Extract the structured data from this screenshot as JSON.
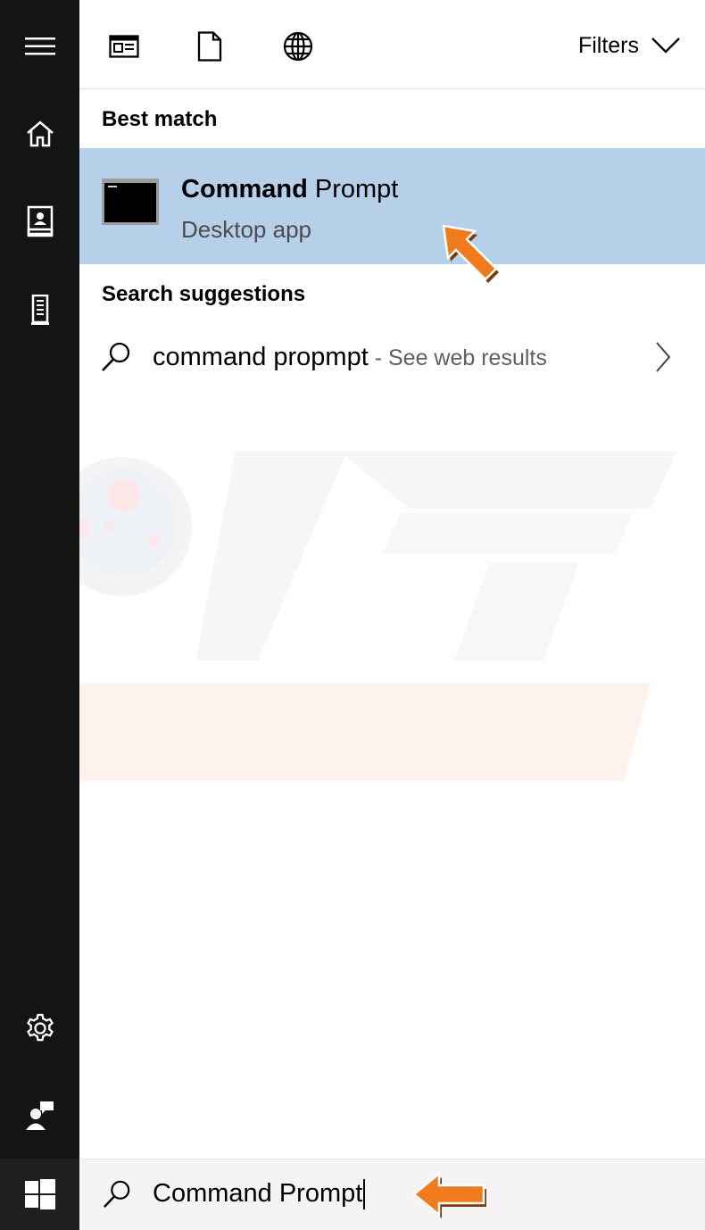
{
  "rail": {
    "items": [
      {
        "name": "menu",
        "icon": "hamburger-menu-icon"
      },
      {
        "name": "home",
        "icon": "home-icon"
      },
      {
        "name": "notebook",
        "icon": "notebook-icon"
      },
      {
        "name": "device",
        "icon": "tower-device-icon"
      }
    ],
    "bottom_items": [
      {
        "name": "settings",
        "icon": "gear-icon"
      },
      {
        "name": "feedback",
        "icon": "feedback-person-icon"
      }
    ],
    "start_icon": "windows-logo-icon"
  },
  "topbar": {
    "scopes": [
      {
        "name": "apps",
        "icon": "apps-scope-icon"
      },
      {
        "name": "documents",
        "icon": "document-icon"
      },
      {
        "name": "web",
        "icon": "globe-icon"
      }
    ],
    "filters_label": "Filters"
  },
  "best_match": {
    "heading": "Best match",
    "title_bold": "Command",
    "title_rest": " Prompt",
    "subtitle": "Desktop app",
    "icon": "command-prompt-icon",
    "highlight_color": "#b5d0e8"
  },
  "suggestions": {
    "heading": "Search suggestions",
    "items": [
      {
        "query": "command propmpt",
        "separator": " - ",
        "hint": "See web results"
      }
    ]
  },
  "search": {
    "value": "Command Prompt"
  },
  "colors": {
    "rail": "#141414",
    "annotation_arrow": "#f07a1c"
  }
}
